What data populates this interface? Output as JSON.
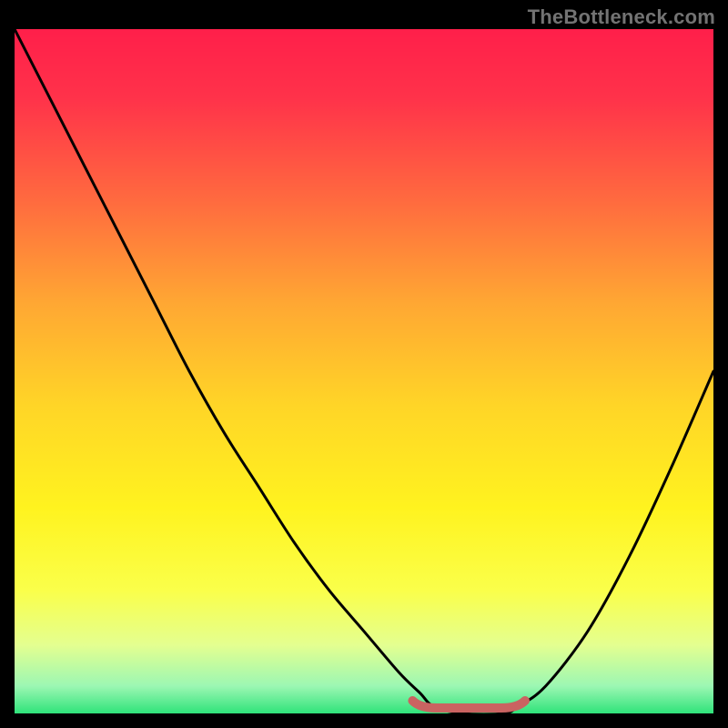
{
  "watermark": "TheBottleneck.com",
  "colors": {
    "gradient_stops": [
      {
        "offset": 0.0,
        "color": "#ff1f4a"
      },
      {
        "offset": 0.1,
        "color": "#ff324a"
      },
      {
        "offset": 0.25,
        "color": "#ff6a3f"
      },
      {
        "offset": 0.4,
        "color": "#ffa733"
      },
      {
        "offset": 0.55,
        "color": "#ffd527"
      },
      {
        "offset": 0.7,
        "color": "#fff31f"
      },
      {
        "offset": 0.82,
        "color": "#faff4a"
      },
      {
        "offset": 0.9,
        "color": "#e4ff90"
      },
      {
        "offset": 0.96,
        "color": "#9cf7b3"
      },
      {
        "offset": 1.0,
        "color": "#2fe37a"
      }
    ],
    "curve": "#000000",
    "flat_marker": "#ca6361",
    "background": "#000000"
  },
  "chart_data": {
    "type": "line",
    "title": "",
    "xlabel": "",
    "ylabel": "",
    "ylim": [
      0,
      100
    ],
    "x": [
      0.0,
      0.05,
      0.1,
      0.15,
      0.2,
      0.25,
      0.3,
      0.35,
      0.4,
      0.45,
      0.5,
      0.55,
      0.58,
      0.6,
      0.64,
      0.7,
      0.72,
      0.76,
      0.82,
      0.88,
      0.94,
      1.0
    ],
    "series": [
      {
        "name": "bottleneck-curve",
        "values": [
          100,
          90,
          80,
          70,
          60,
          50,
          41,
          33,
          25,
          18,
          12,
          6,
          3,
          1,
          0,
          0,
          1,
          4,
          12,
          23,
          36,
          50
        ]
      }
    ],
    "flat_region": {
      "x_start": 0.58,
      "x_end": 0.72,
      "y": 0
    },
    "notes": "x is normalized horizontal position (0=left inner edge, 1=right inner edge); values are approximate percent-height from bottom of the colored plot area. Curve descends from top-left toward a flat minimum around x≈0.6–0.72 then rises to roughly mid-height at the right edge."
  }
}
